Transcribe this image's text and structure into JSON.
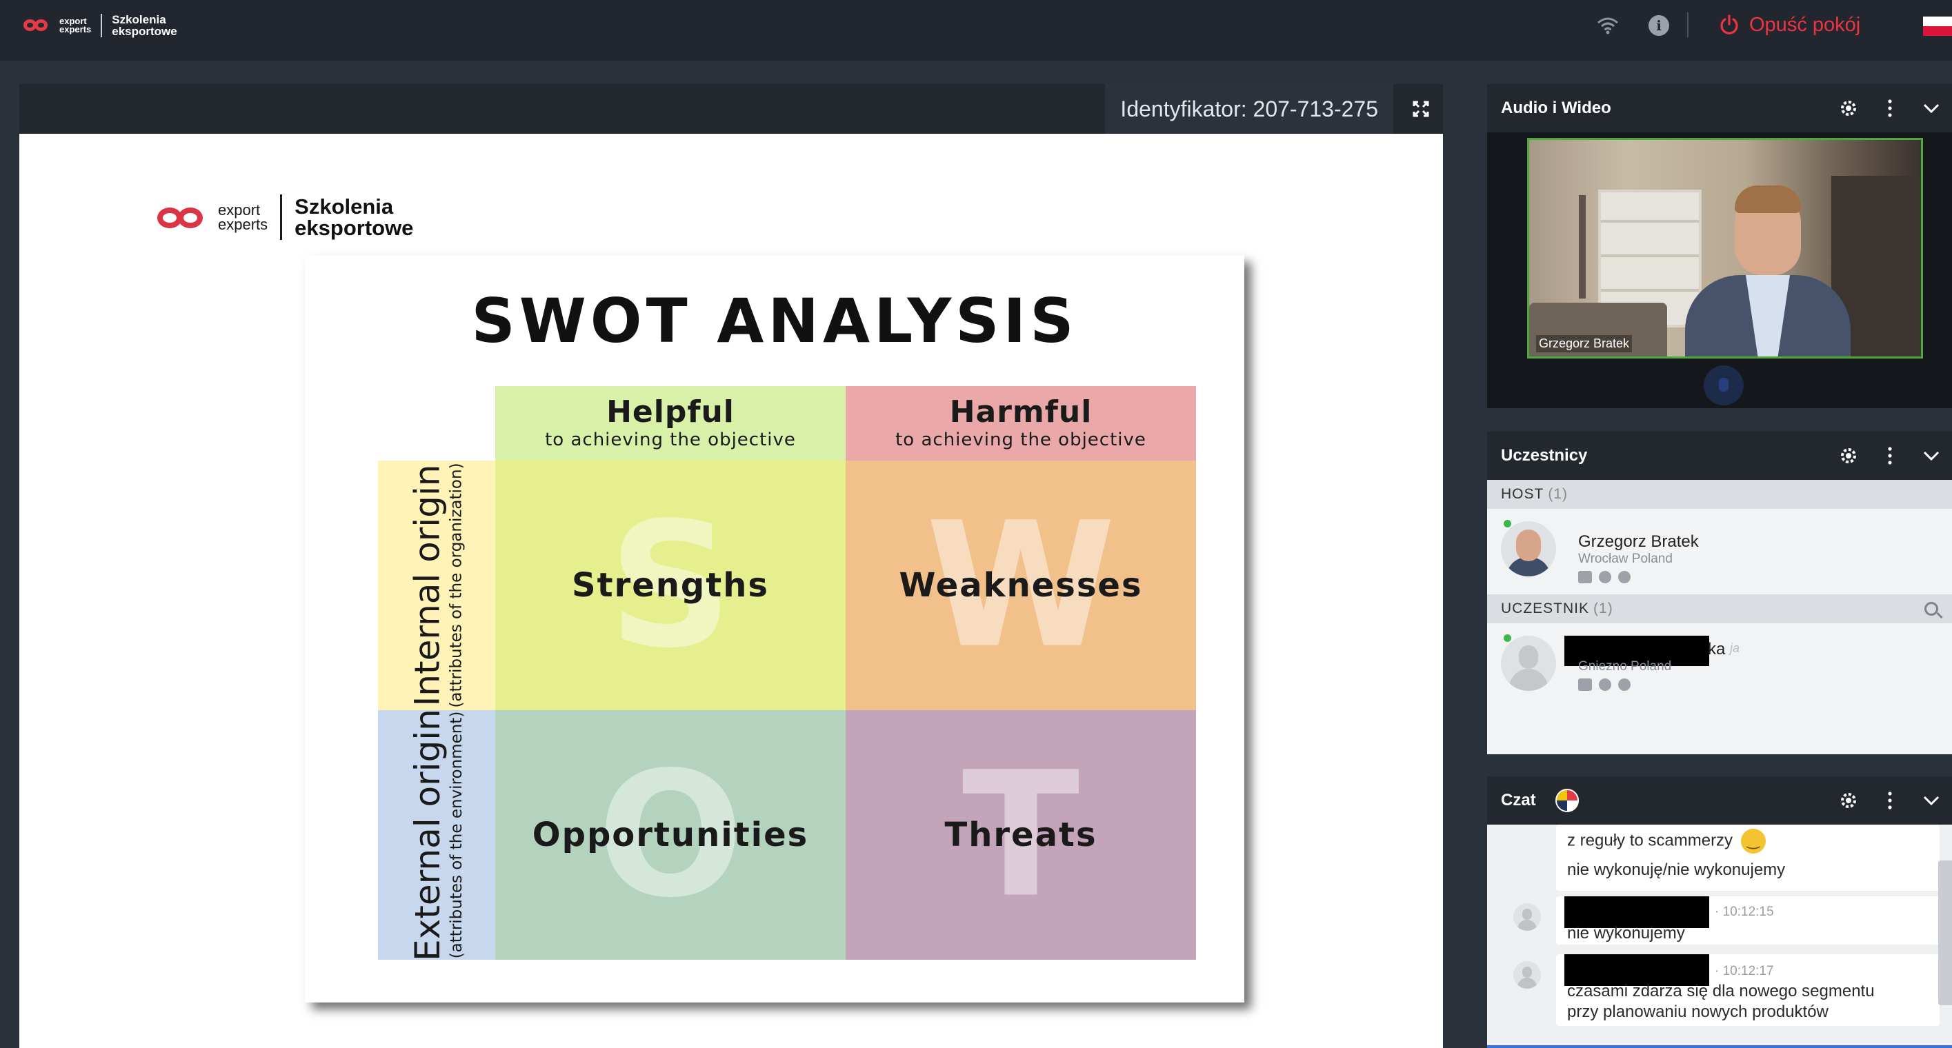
{
  "app": {
    "brand_small_1": "export",
    "brand_small_2": "experts",
    "brand_bold_1": "Szkolenia",
    "brand_bold_2": "eksportowe",
    "leave_label": "Opuść pokój",
    "icons": [
      "wifi-icon",
      "info-icon",
      "power-icon",
      "poland-flag-icon"
    ],
    "accent_color": "#ef3340"
  },
  "stage": {
    "identifier_label": "Identyfikator: 207-713-275"
  },
  "slide": {
    "logo_small_1": "export",
    "logo_small_2": "experts",
    "logo_bold_1": "Szkolenia",
    "logo_bold_2": "eksportowe",
    "title": "SWOT ANALYSIS",
    "col_helpful": "Helpful",
    "col_helpful_sub": "to achieving the objective",
    "col_harmful": "Harmful",
    "col_harmful_sub": "to achieving the objective",
    "row_internal": "Internal origin",
    "row_internal_sub": "(attributes of the organization)",
    "row_external": "External origin",
    "row_external_sub": "(attributes of the environment)",
    "q_strengths": "Strengths",
    "q_weaknesses": "Weaknesses",
    "q_opportunities": "Opportunities",
    "q_threats": "Threats",
    "letter_s": "S",
    "letter_w": "W",
    "letter_o": "O",
    "letter_t": "T"
  },
  "panels": {
    "audio_video": {
      "title": "Audio i Wideo",
      "speaker_name": "Grzegorz Bratek"
    },
    "participants": {
      "title": "Uczestnicy",
      "host_section": "HOST",
      "host_count": "(1)",
      "host": {
        "name": "Grzegorz Bratek",
        "location": "Wrocław Poland"
      },
      "attendee_section": "UCZESTNIK",
      "attendee_count": "(1)",
      "attendee": {
        "name_suffix": "ka",
        "self_tag": "ja",
        "location": "Gniezno Poland"
      }
    },
    "chat": {
      "title": "Czat",
      "messages": [
        {
          "lines": [
            "z reguły to scammerzy",
            "nie wykonuję/nie wykonujemy"
          ]
        },
        {
          "time": "10:12:15",
          "text": "nie wykonujemy"
        },
        {
          "time": "10:12:17",
          "lines": [
            "czasami zdarza się dla nowego segmentu",
            "przy planowaniu nowych produktów"
          ]
        }
      ]
    }
  }
}
